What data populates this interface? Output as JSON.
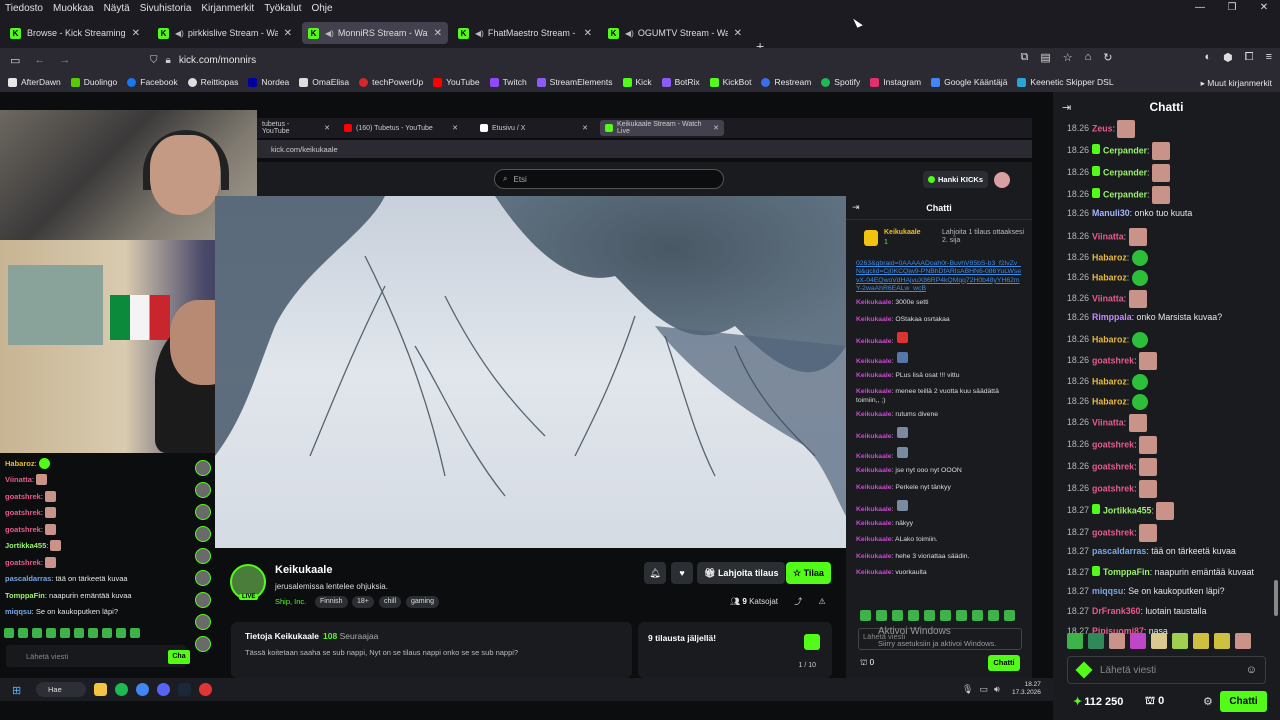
{
  "menubar": {
    "items": [
      "Tiedosto",
      "Muokkaa",
      "Näytä",
      "Sivuhistoria",
      "Kirjanmerkit",
      "Työkalut",
      "Ohje"
    ]
  },
  "tabs": [
    {
      "label": "Browse - Kick Streaming",
      "audio": false,
      "active": false
    },
    {
      "label": "pirkkislive Stream - Watch Li",
      "audio": true,
      "active": false
    },
    {
      "label": "MonniRS Stream - Watch Li",
      "audio": true,
      "active": true
    },
    {
      "label": "FhatMaestro Stream - Watc",
      "audio": true,
      "active": false
    },
    {
      "label": "OGUMTV Stream - Watch Li",
      "audio": true,
      "active": false
    }
  ],
  "urlbar": {
    "url": "kick.com/monnirs"
  },
  "bookmarks": [
    {
      "label": "AfterDawn",
      "color": "#e7e7e7"
    },
    {
      "label": "Duolingo",
      "color": "#58cc02"
    },
    {
      "label": "Facebook",
      "color": "#1877f2"
    },
    {
      "label": "Reittiopas",
      "color": "#dddddd"
    },
    {
      "label": "Nordea",
      "color": "#0000a0"
    },
    {
      "label": "OmaElisa",
      "color": "#dddddd"
    },
    {
      "label": "techPowerUp",
      "color": "#d62828"
    },
    {
      "label": "YouTube",
      "color": "#ff0000"
    },
    {
      "label": "Twitch",
      "color": "#9146ff"
    },
    {
      "label": "StreamElements",
      "color": "#8a5cf5"
    },
    {
      "label": "Kick",
      "color": "#53fc18"
    },
    {
      "label": "BotRix",
      "color": "#8a5cf5"
    },
    {
      "label": "KickBot",
      "color": "#53fc18"
    },
    {
      "label": "Restream",
      "color": "#3a6df0"
    },
    {
      "label": "Spotify",
      "color": "#1db954"
    },
    {
      "label": "Instagram",
      "color": "#e1306c"
    },
    {
      "label": "Google Kääntäjä",
      "color": "#4285f4"
    },
    {
      "label": "Keenetic Skipper DSL",
      "color": "#2aa4d6"
    }
  ],
  "bookmarks_other": "Muut kirjanmerkit",
  "inner_browser": {
    "tabs": [
      {
        "label": "tubetus - YouTube",
        "color": "#ff0000",
        "active": false
      },
      {
        "label": "(160) Tubetus - YouTube",
        "color": "#ff0000",
        "active": false
      },
      {
        "label": "Etusivu / X",
        "color": "#ffffff",
        "active": false
      },
      {
        "label": "Keikukaale Stream - Watch Live",
        "color": "#53fc18",
        "active": true
      }
    ],
    "url": "kick.com/keikukaale",
    "search_placeholder": "Etsi",
    "hanki_label": "Hanki KICKs"
  },
  "mini_chat": [
    {
      "user": "Habaroz",
      "color": "#e9b93a",
      "emote": "green"
    },
    {
      "user": "Viinatta",
      "color": "#e85b8a",
      "emote": "square"
    },
    {
      "user": "goatshrek",
      "color": "#e85b8a",
      "emote": "square"
    },
    {
      "user": "goatshrek",
      "color": "#e85b8a",
      "emote": "square"
    },
    {
      "user": "goatshrek",
      "color": "#e85b8a",
      "emote": "square"
    },
    {
      "user": "Jortikka455",
      "color": "#9bf26b",
      "emote": "square"
    },
    {
      "user": "goatshrek",
      "color": "#e85b8a",
      "emote": "square"
    },
    {
      "user": "pascaldarras",
      "color": "#7aa7e8",
      "text": "tää on tärkeetä kuvaa"
    },
    {
      "user": "TomppaFin",
      "color": "#9bf26b",
      "text": "naapurin emäntää kuvaa"
    },
    {
      "user": "miqqsu",
      "color": "#7aa7e8",
      "text": "Se on kaukoputken läpi?"
    }
  ],
  "mini_input_placeholder": "Lähetä viesti",
  "mini_chat_btn": "Cha",
  "streamer": {
    "name": "Keikukaale",
    "title": "jerusalemissa lentelee ohjuksia.",
    "category": "Ship, Inc.",
    "tags": [
      "Finnish",
      "18+",
      "chill",
      "gaming"
    ],
    "live_badge": "LIVE",
    "gift_label": "Lahjoita tilaus",
    "sub_label": "Tilaa",
    "viewers": "9",
    "viewers_label": "Katsojat"
  },
  "about": {
    "title": "Tietoja Keikukaale",
    "followers": "108",
    "followers_label": "Seuraajaa",
    "description": "Tässä koitetaan saaha se sub nappi, Nyt on se tilaus nappi onko se se sub nappi?"
  },
  "subs_goal": {
    "title": "9 tilausta jäljellä!",
    "progress": "1 / 10"
  },
  "inner_chat": {
    "title": "Chatti",
    "pinned_user": "Keikukaale",
    "pinned_count": "1",
    "pinned_text": "Lahjoita 1 tilaus ottaaksesi 2. sija",
    "link": "0263&gbraid=0AAAAADoah0r-BuvhV85bS-b3_f2lvZv_N&gclid=Cj0KCQjw9-PNBhDfARIsABHN6-086YuLWsevX-04EQwoVdHAjvuX86RP4kQMqq72H0b48yYH62mY-2waAhR6EALw_wcB",
    "messages": [
      {
        "user": "Keikukaale",
        "text": "3000e setti"
      },
      {
        "user": "Keikukaale",
        "text": "OStakaa osrtakaa"
      },
      {
        "user": "Keikukaale",
        "text": ""
      },
      {
        "user": "Keikukaale",
        "text": ""
      },
      {
        "user": "Keikukaale",
        "text": "PLus lisä osat !!! vittu"
      },
      {
        "user": "Keikukaale",
        "text": "menee teillä 2 vuotta kuu säädättä toimiin,, ;)"
      },
      {
        "user": "Keikukaale",
        "text": "rutums divene"
      },
      {
        "user": "Keikukaale",
        "text": ""
      },
      {
        "user": "Keikukaale",
        "text": ""
      },
      {
        "user": "Keikukaale",
        "text": "jse nyt ooo nyt OOON"
      },
      {
        "user": "Keikukaale",
        "text": "Perkele nyt tänkyy"
      },
      {
        "user": "Keikukaale",
        "text": ""
      },
      {
        "user": "Keikukaale",
        "text": "näkyy"
      },
      {
        "user": "Keikukaale",
        "text": "ALako toimiin."
      },
      {
        "user": "Keikukaale",
        "text": "hehe 3 vioriattaa säädin."
      },
      {
        "user": "Keikukaale",
        "text": "vuorkaulta"
      }
    ],
    "input_placeholder": "Lähetä viesti",
    "count": "0",
    "chat_btn": "Chatti"
  },
  "windows_activation": {
    "line1": "Aktivoi Windows",
    "line2": "Siirry asetuksiin ja aktivoi Windows."
  },
  "inner_taskbar": {
    "search": "Hae",
    "time": "18.27",
    "date": "17.3.2026"
  },
  "chat": {
    "title": "Chatti",
    "messages": [
      {
        "ts": "18.26",
        "user": "Zeus",
        "color": "#e85b8a",
        "badge": false,
        "emote": "square"
      },
      {
        "ts": "18.26",
        "user": "Cerpander",
        "color": "#9bf26b",
        "badge": true,
        "emote": "square"
      },
      {
        "ts": "18.26",
        "user": "Cerpander",
        "color": "#9bf26b",
        "badge": true,
        "emote": "square"
      },
      {
        "ts": "18.26",
        "user": "Cerpander",
        "color": "#9bf26b",
        "badge": true,
        "emote": "square"
      },
      {
        "ts": "18.26",
        "user": "Manuli30",
        "color": "#a3b6ff",
        "badge": false,
        "text": "onko tuo kuuta"
      },
      {
        "ts": "18.26",
        "user": "Viinatta",
        "color": "#e85b8a",
        "badge": false,
        "emote": "square"
      },
      {
        "ts": "18.26",
        "user": "Habaroz",
        "color": "#e9b93a",
        "badge": false,
        "emote": "green"
      },
      {
        "ts": "18.26",
        "user": "Habaroz",
        "color": "#e9b93a",
        "badge": false,
        "emote": "green"
      },
      {
        "ts": "18.26",
        "user": "Viinatta",
        "color": "#e85b8a",
        "badge": false,
        "emote": "square"
      },
      {
        "ts": "18.26",
        "user": "Rimppala",
        "color": "#c38bff",
        "badge": false,
        "text": "onko Marsista kuvaa?"
      },
      {
        "ts": "18.26",
        "user": "Habaroz",
        "color": "#e9b93a",
        "badge": false,
        "emote": "green"
      },
      {
        "ts": "18.26",
        "user": "goatshrek",
        "color": "#e85b8a",
        "badge": false,
        "emote": "square"
      },
      {
        "ts": "18.26",
        "user": "Habaroz",
        "color": "#e9b93a",
        "badge": false,
        "emote": "green"
      },
      {
        "ts": "18.26",
        "user": "Habaroz",
        "color": "#e9b93a",
        "badge": false,
        "emote": "green"
      },
      {
        "ts": "18.26",
        "user": "Viinatta",
        "color": "#e85b8a",
        "badge": false,
        "emote": "square"
      },
      {
        "ts": "18.26",
        "user": "goatshrek",
        "color": "#e85b8a",
        "badge": false,
        "emote": "square"
      },
      {
        "ts": "18.26",
        "user": "goatshrek",
        "color": "#e85b8a",
        "badge": false,
        "emote": "square"
      },
      {
        "ts": "18.26",
        "user": "goatshrek",
        "color": "#e85b8a",
        "badge": false,
        "emote": "square"
      },
      {
        "ts": "18.27",
        "user": "Jortikka455",
        "color": "#9bf26b",
        "badge": true,
        "emote": "square"
      },
      {
        "ts": "18.27",
        "user": "goatshrek",
        "color": "#e85b8a",
        "badge": false,
        "emote": "square"
      },
      {
        "ts": "18.27",
        "user": "pascaldarras",
        "color": "#7aa7e8",
        "badge": false,
        "text": "tää on tärkeetä kuvaa"
      },
      {
        "ts": "18.27",
        "user": "TomppaFin",
        "color": "#9bf26b",
        "badge": true,
        "text": "naapurin emäntää kuvaat"
      },
      {
        "ts": "18.27",
        "user": "miqqsu",
        "color": "#7aa7e8",
        "badge": false,
        "text": "Se on kaukoputken läpi?"
      },
      {
        "ts": "18.27",
        "user": "DrFrank360",
        "color": "#e85b8a",
        "badge": false,
        "text": "luotain taustalla"
      },
      {
        "ts": "18.27",
        "user": "Pipisuomi87",
        "color": "#e85b8a",
        "badge": false,
        "text": "nasa"
      }
    ],
    "input_placeholder": "Lähetä viesti",
    "points": "112 250",
    "gift_count": "0",
    "chat_btn": "Chatti"
  }
}
